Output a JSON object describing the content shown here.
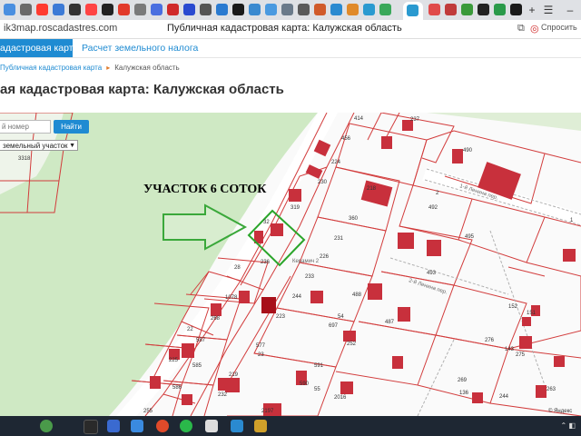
{
  "browser": {
    "url": "ik3map.roscadastres.com",
    "page_title": "Публичная кадастровая карта: Калужская область",
    "translate_label": "Спросить"
  },
  "site_nav": {
    "active_tab": "адастровая карта",
    "tab2": "Расчет земельного налога"
  },
  "breadcrumbs": {
    "link": "Публичная кадастровая карта",
    "current": "Калужская область"
  },
  "heading": "ая кадастровая карта: Калужская область",
  "search": {
    "placeholder": "й номер",
    "button": "Найти",
    "type_selected": "земельный участок"
  },
  "map": {
    "annotation": "УЧАСТОК 6 СОТОК",
    "street_label": "Керамич 2",
    "lane_label1": "1-й Ленина пер.",
    "lane_label2": "2-й Ленина пер.",
    "yandex": "© Яндекс",
    "lot_numbers": [
      "414",
      "456",
      "237",
      "224",
      "230",
      "218",
      "490",
      "492",
      "3318",
      "319",
      "32",
      "360",
      "231",
      "493",
      "495",
      "226",
      "233",
      "236",
      "28",
      "1078",
      "268",
      "223",
      "244",
      "54",
      "697",
      "488",
      "487",
      "252",
      "22",
      "587",
      "577",
      "23",
      "591",
      "219",
      "225",
      "585",
      "586",
      "590",
      "55",
      "2016",
      "232",
      "2197",
      "255",
      "269",
      "244",
      "152",
      "151",
      "275",
      "276",
      "143",
      "136",
      "263",
      "2",
      "1"
    ]
  },
  "colors": {
    "accent": "#1f8bd2",
    "parcel_border": "#d23c3c",
    "building": "#c8303c",
    "forest": "#cfe9c4",
    "arrow": "#3aa83a",
    "highlight": "#2aa52a"
  }
}
